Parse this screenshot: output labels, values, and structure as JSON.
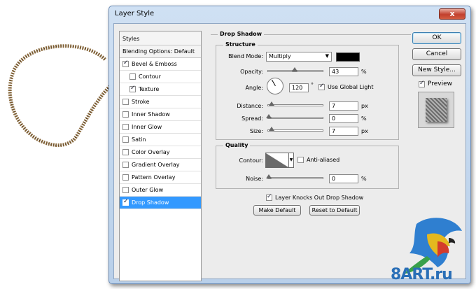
{
  "window": {
    "title": "Layer Style",
    "close_label": "x"
  },
  "style_list": {
    "header": "Styles",
    "blending_options": "Blending Options: Default",
    "items": [
      {
        "label": "Bevel & Emboss",
        "checked": true,
        "sub": false
      },
      {
        "label": "Contour",
        "checked": false,
        "sub": true
      },
      {
        "label": "Texture",
        "checked": true,
        "sub": true
      },
      {
        "label": "Stroke",
        "checked": false,
        "sub": false
      },
      {
        "label": "Inner Shadow",
        "checked": false,
        "sub": false
      },
      {
        "label": "Inner Glow",
        "checked": false,
        "sub": false
      },
      {
        "label": "Satin",
        "checked": false,
        "sub": false
      },
      {
        "label": "Color Overlay",
        "checked": false,
        "sub": false
      },
      {
        "label": "Gradient Overlay",
        "checked": false,
        "sub": false
      },
      {
        "label": "Pattern Overlay",
        "checked": false,
        "sub": false
      },
      {
        "label": "Outer Glow",
        "checked": false,
        "sub": false
      },
      {
        "label": "Drop Shadow",
        "checked": true,
        "sub": false,
        "selected": true
      }
    ]
  },
  "drop_shadow": {
    "title": "Drop Shadow",
    "structure": {
      "title": "Structure",
      "blend_mode_label": "Blend Mode:",
      "blend_mode_value": "Multiply",
      "shadow_color": "#000000",
      "opacity_label": "Opacity:",
      "opacity_value": "43",
      "opacity_unit": "%",
      "angle_label": "Angle:",
      "angle_value": "120",
      "angle_unit": "°",
      "global_light_label": "Use Global Light",
      "global_light_checked": true,
      "distance_label": "Distance:",
      "distance_value": "7",
      "distance_unit": "px",
      "spread_label": "Spread:",
      "spread_value": "0",
      "spread_unit": "%",
      "size_label": "Size:",
      "size_value": "7",
      "size_unit": "px"
    },
    "quality": {
      "title": "Quality",
      "contour_label": "Contour:",
      "anti_aliased_label": "Anti-aliased",
      "anti_aliased_checked": false,
      "noise_label": "Noise:",
      "noise_value": "0",
      "noise_unit": "%"
    },
    "knockout_label": "Layer Knocks Out Drop Shadow",
    "knockout_checked": true,
    "make_default_label": "Make Default",
    "reset_default_label": "Reset to Default"
  },
  "buttons": {
    "ok": "OK",
    "cancel": "Cancel",
    "new_style": "New Style..."
  },
  "preview": {
    "label": "Preview",
    "checked": true
  },
  "watermark": {
    "text": "8ART.ru"
  }
}
